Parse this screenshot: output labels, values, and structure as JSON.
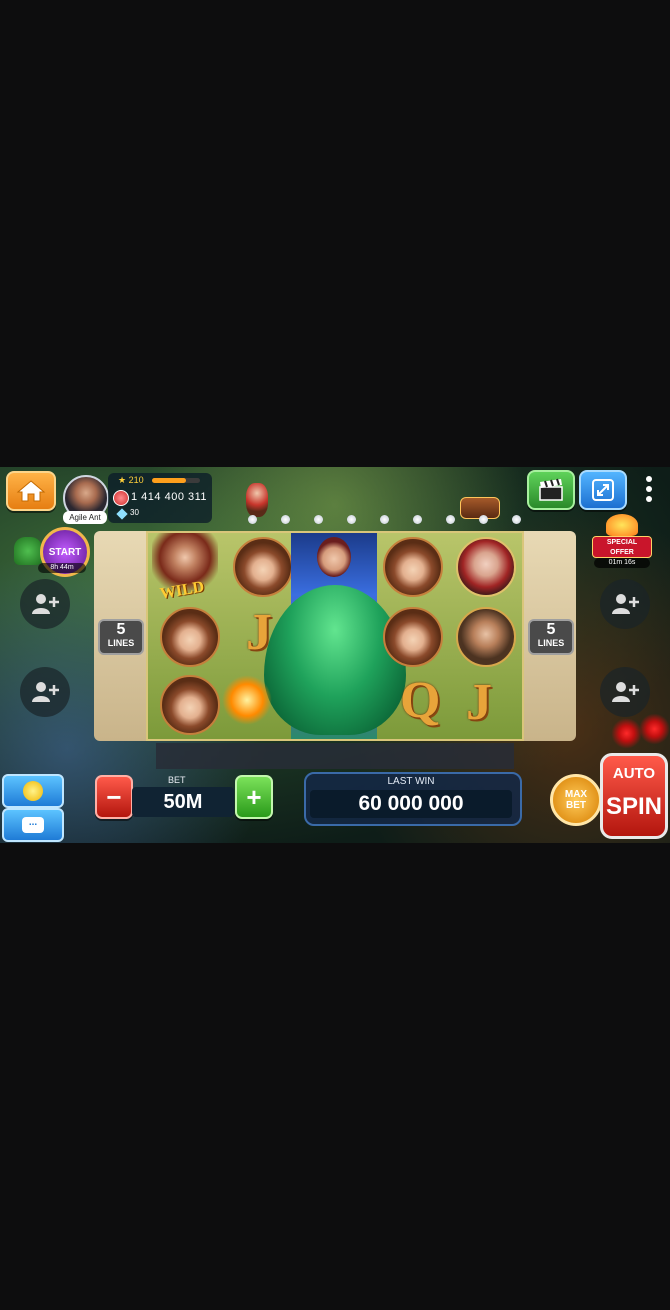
{
  "profile": {
    "username": "Agile Ant",
    "level": "210",
    "xp_progress": 0.7,
    "coins": "1 414 400 311",
    "gems": "30"
  },
  "icons": {
    "home": "home-icon",
    "clapper": "video-clapper-icon",
    "fullscreen": "fullscreen-icon",
    "menu": "more-vertical-icon",
    "add_friend": "add-friend-icon",
    "emoji": "emoji-icon",
    "chat": "chat-icon"
  },
  "start_event": {
    "label": "START",
    "timer": "8h 44m"
  },
  "special_offer": {
    "label_line1": "SPECIAL",
    "label_line2": "OFFER",
    "timer": "01m 16s"
  },
  "lines": {
    "left_count": "5",
    "left_label": "LINES",
    "right_count": "5",
    "right_label": "LINES"
  },
  "reels": {
    "wild_text": "WILD",
    "letters": [
      "J",
      "J",
      "Q",
      "J"
    ]
  },
  "bet": {
    "label": "BET",
    "value": "50M",
    "minus": "−",
    "plus": "+"
  },
  "last_win": {
    "label": "LAST WIN",
    "value": "60 000 000"
  },
  "max_bet": {
    "line1": "MAX",
    "line2": "BET"
  },
  "spin": {
    "auto_label": "AUTO",
    "spin_label": "SPIN"
  },
  "chat_glyph": "...",
  "colors": {
    "home_button": "#f39a2b",
    "spin_button": "#e4271a",
    "plus_button": "#45bd2a",
    "minus_button": "#e4271a",
    "accent_gold": "#ffcf3a"
  }
}
